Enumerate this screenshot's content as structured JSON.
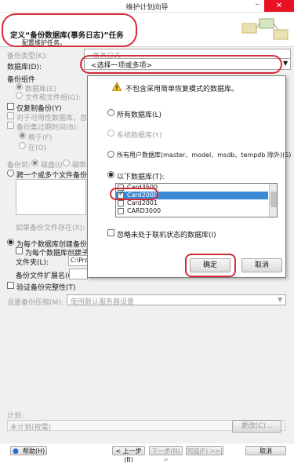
{
  "window": {
    "title": "维护计划向导",
    "close_icon": "✕",
    "minimize_icon": "–"
  },
  "header": {
    "title": "定义“备份数据库(事务日志)”任务",
    "subtitle": "配置维护任务。"
  },
  "form": {
    "backup_type_label": "备份类型(K):",
    "backup_type_value": "事务日志",
    "database_label": "数据库(D):",
    "database_placeholder": "<选择一项或多项>",
    "backup_component_label": "备份组件",
    "component_database": "数据库(E)",
    "component_file": "文件和文件组(G):",
    "copy_only_label": "仅复制备份(Y)",
    "availability_label": "对于可用性数据库，忽略备份",
    "expire_label": "备份集过期时间(B):",
    "expire_after": "晚于(F)",
    "expire_on": "在(O)",
    "backup_to_label": "备份到:",
    "backup_to_disk": "磁盘(I)",
    "backup_to_tape": "磁带(P)",
    "span_label": "跨一个或多个文件备份数据库(S):",
    "if_exists_label": "如果备份文件存在(X):",
    "per_db_label": "为每个数据库创建备份文件(R)",
    "subdir_label": "为每个数据库创建子目录(U)",
    "folder_label": "文件夹(L):",
    "folder_value": "C:\\Progr",
    "ext_label": "备份文件扩展名(0):",
    "verify_label": "验证备份完整性(T)",
    "compression_label": "设置备份压缩(M):",
    "compression_value": "使用默认服务器设置",
    "schedule_label": "计划:",
    "schedule_value": "未计划(按需)",
    "change_button": "更改(C)..."
  },
  "popup": {
    "warning": "不包含采用简单恢复模式的数据库。",
    "all_dbs": "所有数据库(L)",
    "system_dbs": "系统数据库(Y)",
    "all_user_dbs": "所有用户数据库(master、model、msdb、tempdb 除外)(S)",
    "these_dbs": "以下数据库(T):",
    "db_list": [
      "Card3500",
      "Card2000",
      "Card2001",
      "CARD3000"
    ],
    "selected_db": "Card2000",
    "ignore_offline": "忽略未处于联机状态的数据库(I)",
    "ok_button": "确定",
    "cancel_button": "取消"
  },
  "footer": {
    "help": "帮助(H)",
    "back": "< 上一步(B)",
    "next": "下一步(N) >",
    "finish": "完成(F) >>|",
    "cancel": "取消"
  }
}
